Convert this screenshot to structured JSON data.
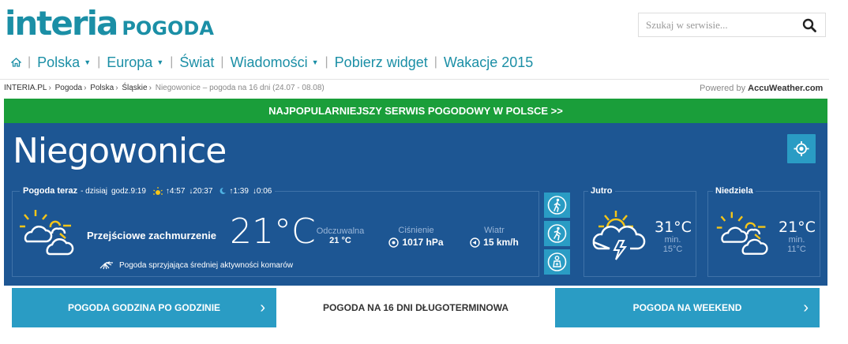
{
  "header": {
    "logo_main": "INTERIA",
    "logo_sub": "POGODA",
    "search_placeholder": "Szukaj w serwisie..."
  },
  "nav": {
    "items": [
      {
        "label": "Polska",
        "dropdown": true
      },
      {
        "label": "Europa",
        "dropdown": true
      },
      {
        "label": "Świat",
        "dropdown": false
      },
      {
        "label": "Wiadomości",
        "dropdown": true
      },
      {
        "label": "Pobierz widget",
        "dropdown": false
      },
      {
        "label": "Wakacje 2015",
        "dropdown": false
      }
    ]
  },
  "breadcrumb": {
    "items": [
      "INTERIA.PL",
      "Pogoda",
      "Polska",
      "Śląskie"
    ],
    "current": "Niegowonice – pogoda na 16 dni (24.07 - 08.08)"
  },
  "powered": {
    "prefix": "Powered by",
    "brand": "AccuWeather.com"
  },
  "banner": "NAJPOPULARNIEJSZY SERWIS POGODOWY W POLSCE >>",
  "city": "Niegowonice",
  "now": {
    "title": "Pogoda teraz",
    "day": "- dzisiaj",
    "time": "godz.9:19",
    "sunrise": "4:57",
    "sunset": "20:37",
    "moonrise": "1:39",
    "moonset": "0:06",
    "description": "Przejściowe zachmurzenie",
    "temp": "21°C",
    "feels_label": "Odczuwalna",
    "feels_value": "21 °C",
    "pressure_label": "Ciśnienie",
    "pressure_value": "1017 hPa",
    "wind_label": "Wiatr",
    "wind_value": "15 km/h",
    "mosquito_text": "Pogoda sprzyjająca średniej aktywności komarów"
  },
  "forecast": [
    {
      "day": "Jutro",
      "temp": "31°C",
      "min_label": "min.",
      "min": "15°C"
    },
    {
      "day": "Niedziela",
      "temp": "21°C",
      "min_label": "min.",
      "min": "11°C"
    }
  ],
  "tabs": [
    {
      "label": "POGODA GODZINA PO GODZINIE",
      "active": false
    },
    {
      "label": "POGODA NA 16 DNI DŁUGOTERMINOWA",
      "active": true
    },
    {
      "label": "POGODA NA WEEKEND",
      "active": false
    }
  ],
  "colors": {
    "brand": "#1b8fa6",
    "panel": "#1d5693",
    "accent": "#2a9cc4",
    "banner": "#1a9e3a",
    "sun": "#f5c518"
  }
}
